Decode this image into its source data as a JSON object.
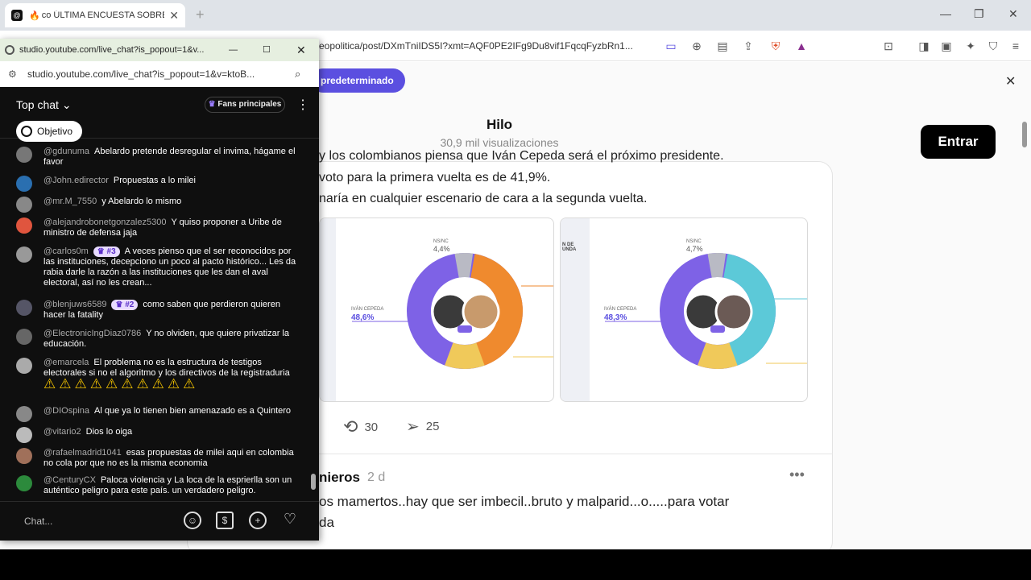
{
  "browser": {
    "tab_title": "ÚLTIMA ENCUESTA SOBRE",
    "tab_prefix": "co",
    "url": "eopolitica/post/DXmTniIDS5I?xmt=AQF0PE2IFg9Du8vif1FqcqFyzbRn1...",
    "banner_pill": "predeterminado"
  },
  "page": {
    "header_title": "Hilo",
    "header_views": "30,9 mil visualizaciones",
    "login_button": "Entrar",
    "post_lines": [
      "y los colombianos piensa que Iván Cepeda será el próximo presidente.",
      "voto para la primera vuelta es de 41,9%.",
      "naría en cualquier escenario de cara a la segunda vuelta."
    ],
    "charts": [
      {
        "ivan_label": "IVÁN CEPEDA",
        "ivan_value": "48,6%",
        "nsnr_label": "NS/NC",
        "nsnr_value": "4,4%",
        "side_label": "",
        "accent": "#ef8a2e"
      },
      {
        "ivan_label": "IVÁN CEPEDA",
        "ivan_value": "48,3%",
        "nsnr_label": "NS/NC",
        "nsnr_value": "4,7%",
        "side_label": "N DE\nUNDA",
        "accent": "#5cc9d8"
      }
    ],
    "reposts": "30",
    "shares": "25",
    "reply": {
      "name": "nieros",
      "time": "2 d",
      "lines": [
        "os mamertos..hay que ser imbecil..bruto y malparid...o.....para votar",
        "da"
      ]
    }
  },
  "popup": {
    "title": "studio.youtube.com/live_chat?is_popout=1&v...",
    "url": "studio.youtube.com/live_chat?is_popout=1&v=ktoB...",
    "top_chat": "Top chat",
    "fans_label": "Fans principales",
    "objetivo": "Objetivo",
    "chat_placeholder": "Chat...",
    "messages": [
      {
        "author": "@gdunuma",
        "badge": "",
        "text": "Abelardo pretende desregular el invima, hágame el favor",
        "av": "#777"
      },
      {
        "author": "@John.edirector",
        "badge": "",
        "text": "Propuestas a lo milei",
        "av": "#2a6fb0"
      },
      {
        "author": "@mr.M_7550",
        "badge": "",
        "text": "y Abelardo lo mismo",
        "av": "#888"
      },
      {
        "author": "@alejandrobonetgonzalez5300",
        "badge": "",
        "text": "Y quiso proponer a Uribe de ministro de defensa jaja",
        "av": "#e0553e"
      },
      {
        "author": "@carlos0m",
        "badge": "#3",
        "text": "A veces pienso que el ser reconocidos por las instituciones, decepciono un poco al pacto histórico... Les da rabia darle la razón a las instituciones que les dan el aval electoral, así no les crean...",
        "av": "#999"
      },
      {
        "author": "@blenjuws6589",
        "badge": "#2",
        "text": "como saben que perdieron quieren hacer la fatality",
        "av": "#556"
      },
      {
        "author": "@ElectronicIngDiaz0786",
        "badge": "",
        "text": "Y no olviden, que quiere privatizar la educación.",
        "av": "#666"
      },
      {
        "author": "@emarcela",
        "badge": "",
        "text": "El problema no es la estructura de testigos electorales si no el algoritmo y los directivos de la registraduria",
        "warn": "⚠⚠⚠⚠⚠⚠⚠⚠⚠⚠",
        "av": "#aaa"
      },
      {
        "author": "@DIOspina",
        "badge": "",
        "text": "Al que ya lo tienen bien amenazado es a Quintero",
        "av": "#888"
      },
      {
        "author": "@vitario2",
        "badge": "",
        "text": "Dios lo oiga",
        "av": "#bbb"
      },
      {
        "author": "@rafaelmadrid1041",
        "badge": "",
        "text": "esas propuestas de milei aqui en colombia no cola por que no es la misma economia",
        "av": "#a0705a"
      },
      {
        "author": "@CenturyCX",
        "badge": "",
        "text": "Paloca violencia y La loca de la esprierlla son un auténtico peligro para este país. un verdadero peligro.",
        "av": "#2c8a3c"
      }
    ]
  }
}
